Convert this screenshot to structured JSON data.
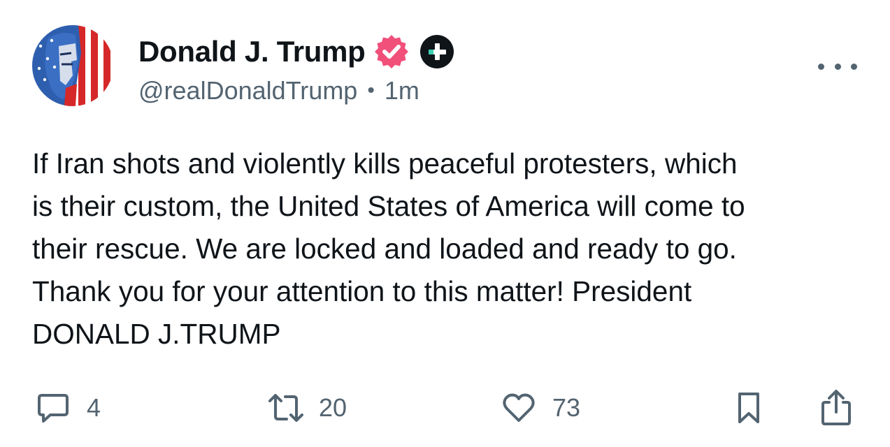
{
  "author": {
    "display_name": "Donald J. Trump",
    "handle": "@realDonaldTrump",
    "time": "1m",
    "separator": "•",
    "verified_color": "#f0507a"
  },
  "post": {
    "lines": [
      "If Iran shots and violently kills peaceful protesters, which",
      "is their custom, the United States of America will come to",
      "their rescue. We are locked and loaded and ready to go.",
      "Thank you for your attention to this matter! President",
      "DONALD J.TRUMP"
    ]
  },
  "actions": {
    "reply_count": "4",
    "repost_count": "20",
    "like_count": "73",
    "reply_icon": "comment-bubble-icon",
    "repost_icon": "repost-arrows-icon",
    "like_icon": "heart-icon",
    "bookmark_icon": "bookmark-icon",
    "share_icon": "share-icon"
  }
}
